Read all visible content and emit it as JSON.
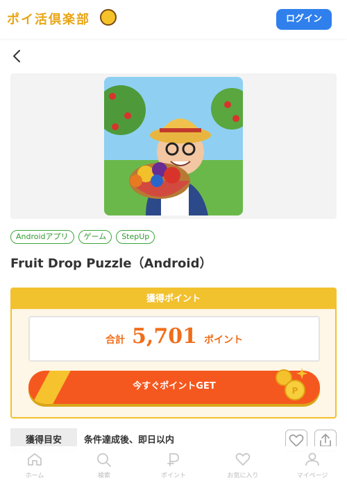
{
  "header": {
    "logo_text": "ポイ活倶楽部",
    "login_label": "ログイン"
  },
  "offer": {
    "image_alt": "Fruit Drop Puzzle app icon",
    "tags": [
      "Androidアプリ",
      "ゲーム",
      "StepUp"
    ],
    "title": "Fruit Drop Puzzle（Android）"
  },
  "points": {
    "header": "獲得ポイント",
    "total_label": "合計",
    "total_value": "5,701",
    "unit": "ポイント",
    "cta_label": "今すぐポイントGET"
  },
  "estimate": {
    "label": "獲得目安",
    "text": "条件達成後、即日以内"
  },
  "tabbar": {
    "items": [
      {
        "label": "ホーム",
        "icon": "home-icon"
      },
      {
        "label": "検索",
        "icon": "search-icon"
      },
      {
        "label": "ポイント",
        "icon": "points-icon"
      },
      {
        "label": "お気に入り",
        "icon": "heart-icon"
      },
      {
        "label": "マイページ",
        "icon": "user-icon"
      }
    ]
  },
  "colors": {
    "brand_yellow": "#f2c12e",
    "cta_orange": "#f5581e",
    "login_blue": "#2f80ed",
    "tag_green": "#3aa63a"
  }
}
